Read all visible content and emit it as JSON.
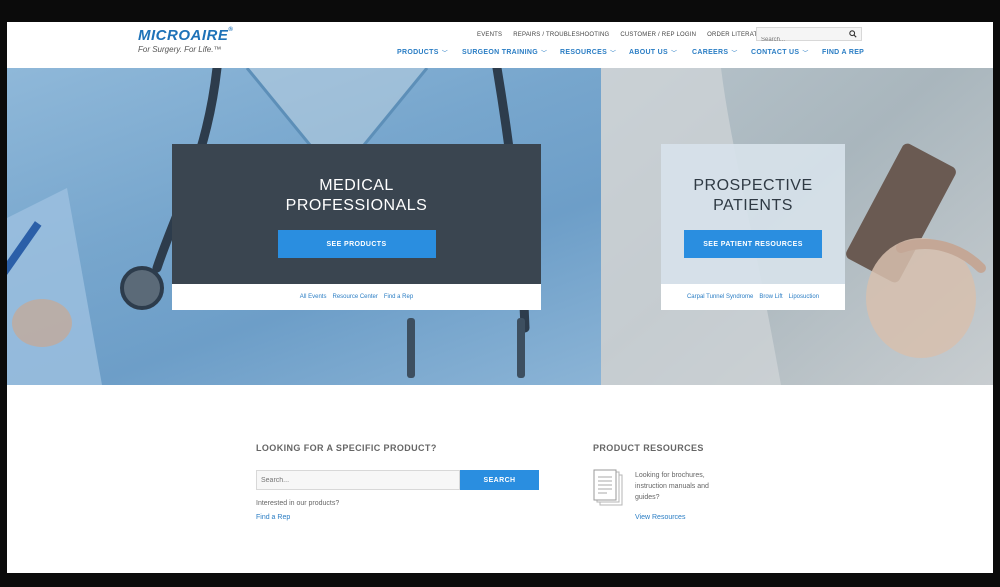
{
  "brand": {
    "name": "MICROAIRE",
    "reg": "®",
    "tagline": "For Surgery. For Life.™"
  },
  "utility_nav": [
    "EVENTS",
    "REPAIRS / TROUBLESHOOTING",
    "CUSTOMER / REP LOGIN",
    "ORDER LITERATURE"
  ],
  "header_search": {
    "placeholder": "Search..."
  },
  "main_nav": [
    {
      "label": "PRODUCTS",
      "dropdown": true
    },
    {
      "label": "SURGEON TRAINING",
      "dropdown": true
    },
    {
      "label": "RESOURCES",
      "dropdown": true
    },
    {
      "label": "ABOUT US",
      "dropdown": true
    },
    {
      "label": "CAREERS",
      "dropdown": true
    },
    {
      "label": "CONTACT US",
      "dropdown": true
    },
    {
      "label": "FIND A REP",
      "dropdown": false
    }
  ],
  "hero": {
    "medical": {
      "title_line1": "MEDICAL",
      "title_line2": "PROFESSIONALS",
      "button": "SEE PRODUCTS",
      "links": [
        "All Events",
        "Resource Center",
        "Find a Rep"
      ]
    },
    "patients": {
      "title_line1": "PROSPECTIVE",
      "title_line2": "PATIENTS",
      "button": "SEE PATIENT RESOURCES",
      "links": [
        "Carpal Tunnel Syndrome",
        "Brow Lift",
        "Liposuction"
      ]
    }
  },
  "product_search": {
    "title": "LOOKING FOR A SPECIFIC PRODUCT?",
    "placeholder": "Search...",
    "button": "SEARCH",
    "interest_text": "Interested in our products?",
    "find_rep": "Find a Rep"
  },
  "product_resources": {
    "title": "PRODUCT RESOURCES",
    "text": "Looking for brochures, instruction manuals and guides?",
    "link": "View Resources"
  },
  "colors": {
    "accent_blue": "#2a8ee0",
    "link_blue": "#2a7dc4",
    "dark_card": "#3a4550",
    "hero_left": "#77a6cd",
    "hero_right": "#b7c4cc"
  }
}
